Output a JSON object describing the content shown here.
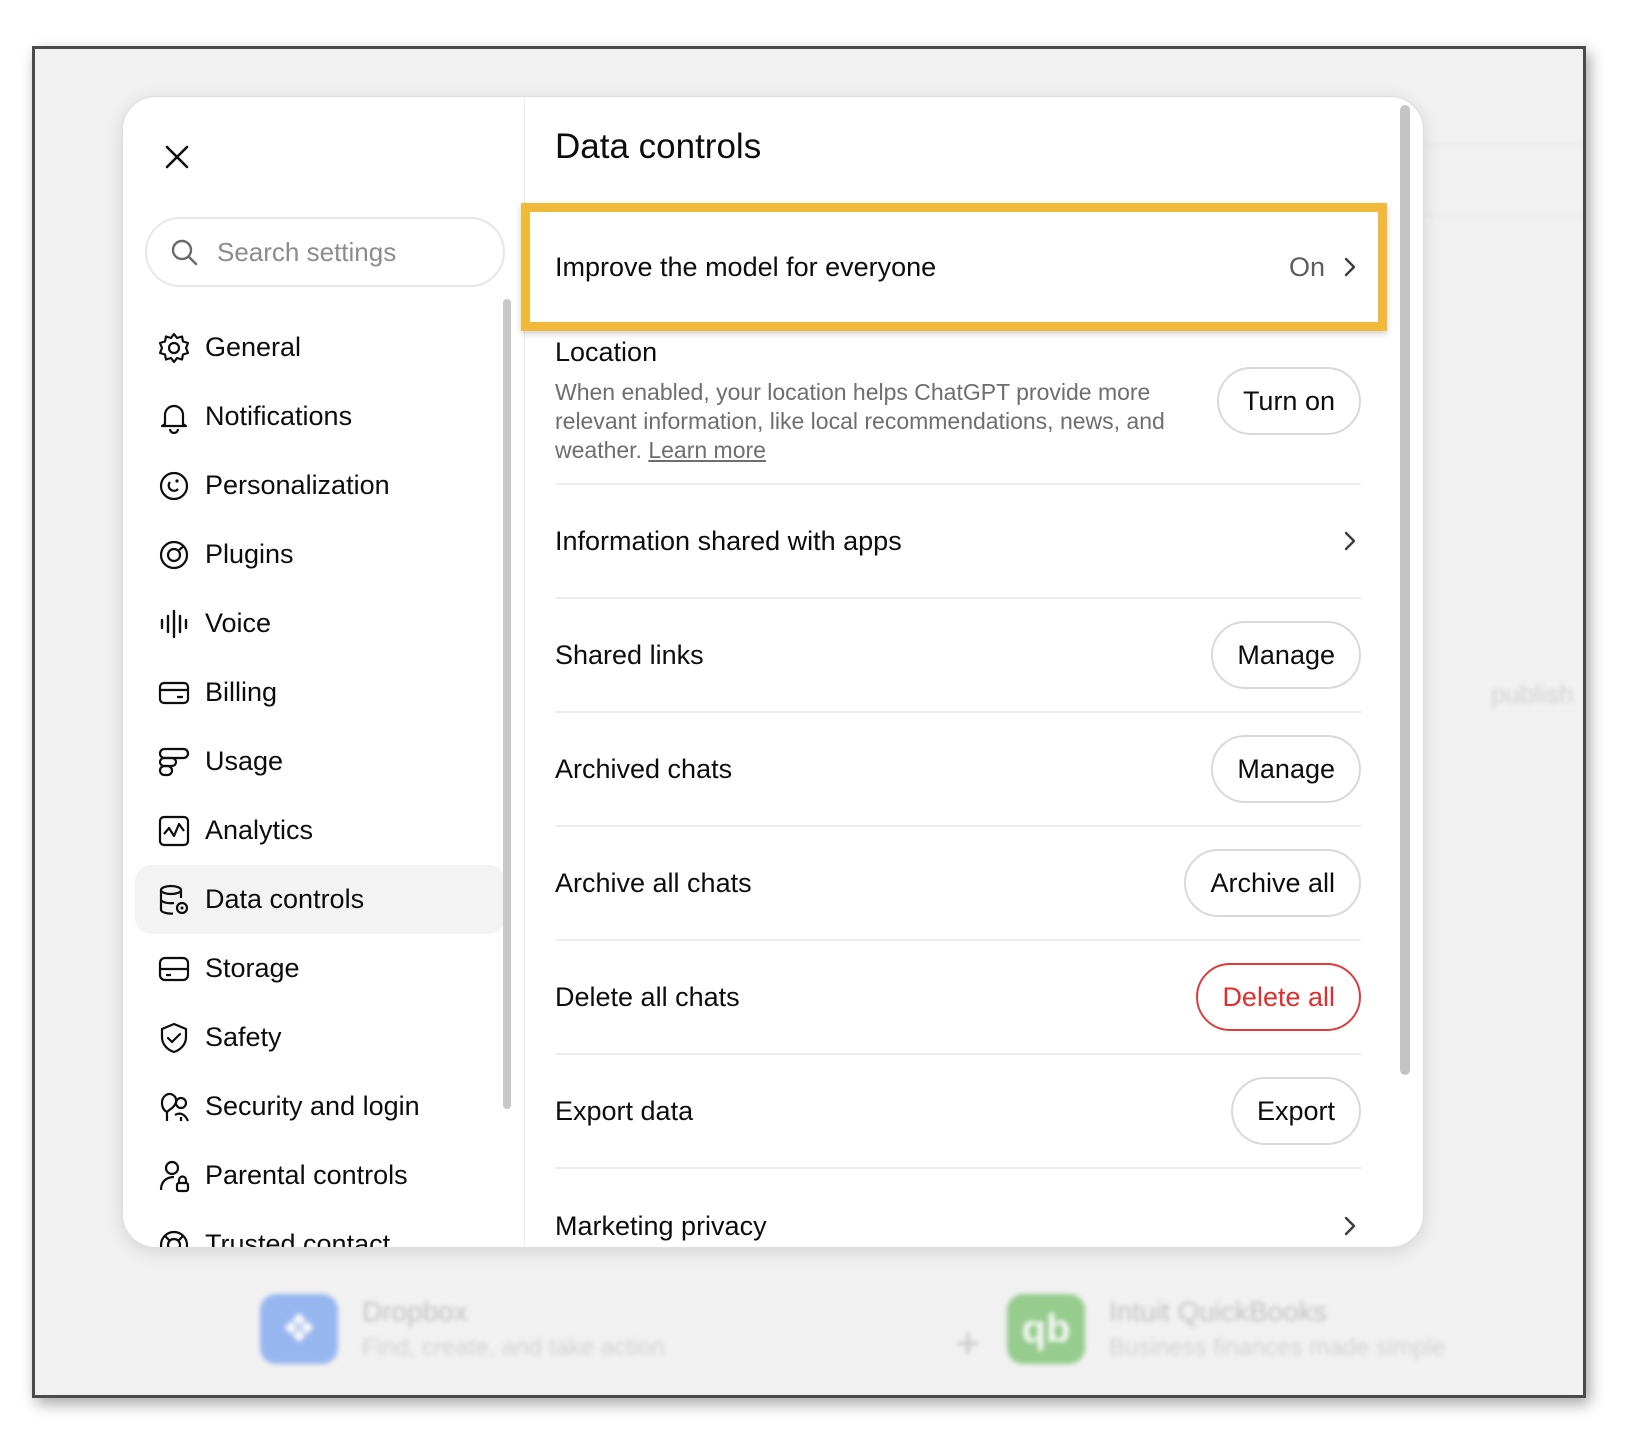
{
  "background": {
    "publish_text": "publish",
    "apps": [
      {
        "name": "Dropbox",
        "desc": "Find, create, and take action",
        "color": "#2d6cf5"
      },
      {
        "name": "Intuit QuickBooks",
        "desc": "Business finances made simple",
        "color": "#2ca01c"
      }
    ],
    "plus": "+"
  },
  "modal": {
    "search_placeholder": "Search settings",
    "nav": [
      {
        "label": "General",
        "icon": "gear-icon"
      },
      {
        "label": "Notifications",
        "icon": "bell-icon"
      },
      {
        "label": "Personalization",
        "icon": "personalization-icon"
      },
      {
        "label": "Plugins",
        "icon": "plugins-icon"
      },
      {
        "label": "Voice",
        "icon": "voice-waveform-icon"
      },
      {
        "label": "Billing",
        "icon": "credit-card-icon"
      },
      {
        "label": "Usage",
        "icon": "usage-icon"
      },
      {
        "label": "Analytics",
        "icon": "analytics-icon"
      },
      {
        "label": "Data controls",
        "icon": "database-gear-icon",
        "active": true
      },
      {
        "label": "Storage",
        "icon": "storage-icon"
      },
      {
        "label": "Safety",
        "icon": "shield-check-icon"
      },
      {
        "label": "Security and login",
        "icon": "security-icon"
      },
      {
        "label": "Parental controls",
        "icon": "parental-controls-icon"
      },
      {
        "label": "Trusted contact",
        "icon": "lifebuoy-icon"
      }
    ],
    "title": "Data controls",
    "improve": {
      "label": "Improve the model for everyone",
      "value": "On"
    },
    "location": {
      "label": "Location",
      "desc": "When enabled, your location helps ChatGPT provide more relevant information, like local recommendations, news, and weather.",
      "link": "Learn more",
      "button": "Turn on"
    },
    "info_apps": {
      "label": "Information shared with apps"
    },
    "shared_links": {
      "label": "Shared links",
      "button": "Manage"
    },
    "archived_chats": {
      "label": "Archived chats",
      "button": "Manage"
    },
    "archive_all": {
      "label": "Archive all chats",
      "button": "Archive all"
    },
    "delete_all": {
      "label": "Delete all chats",
      "button": "Delete all"
    },
    "export": {
      "label": "Export data",
      "button": "Export"
    },
    "marketing": {
      "label": "Marketing privacy"
    },
    "colors": {
      "highlight": "#f0b93a",
      "danger": "#e02e2e"
    }
  }
}
